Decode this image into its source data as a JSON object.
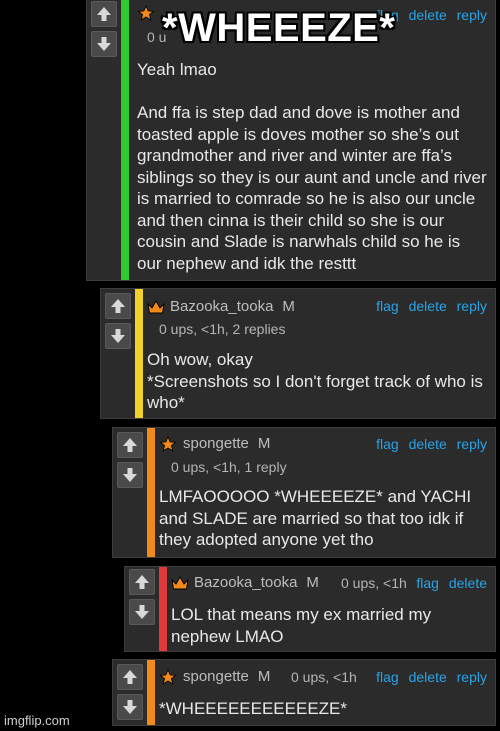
{
  "overlay_caption": "*WHEEEZE*",
  "watermark": "imgflip.com",
  "colors": {
    "link": "#2aa3e6",
    "green": "#2fcb2f",
    "yellow": "#f2d22a",
    "orange": "#f08a1c",
    "red": "#e0393c"
  },
  "comments": [
    {
      "meta": "0 u",
      "actions": [
        "flag",
        "delete",
        "reply"
      ],
      "body": "Yeah lmao\n\nAnd ffa is step dad and dove is mother and toasted apple is doves mother so she’s out grandmother and river and winter are ffa’s siblings so they is our aunt and uncle and river is married to comrade so he is also our uncle and then cinna is their child so she is our cousin and Slade is narwhals child so he is our nephew and idk the resttt"
    },
    {
      "user": "Bazooka_tooka",
      "badge": "M",
      "icon": "crown-icon",
      "meta": "0 ups, <1h, 2 replies",
      "actions": [
        "flag",
        "delete",
        "reply"
      ],
      "body": "Oh wow, okay\n*Screenshots so I don't forget track of who is who*"
    },
    {
      "user": "spongette",
      "badge": "M",
      "icon": "star-icon",
      "meta": "0 ups, <1h, 1 reply",
      "actions": [
        "flag",
        "delete",
        "reply"
      ],
      "body": "LMFAOOOOO *WHEEEEZE* and YACHI and SLADE are married so that too idk if they adopted anyone yet tho"
    },
    {
      "user": "Bazooka_tooka",
      "badge": "M",
      "icon": "crown-icon",
      "meta": "0 ups, <1h",
      "actions": [
        "flag",
        "delete"
      ],
      "body": "LOL that means my ex married my nephew LMAO"
    },
    {
      "user": "spongette",
      "badge": "M",
      "icon": "star-icon",
      "meta": "0 ups, <1h",
      "actions": [
        "flag",
        "delete",
        "reply"
      ],
      "body": "*WHEEEEEEEEEEEZE*"
    }
  ]
}
